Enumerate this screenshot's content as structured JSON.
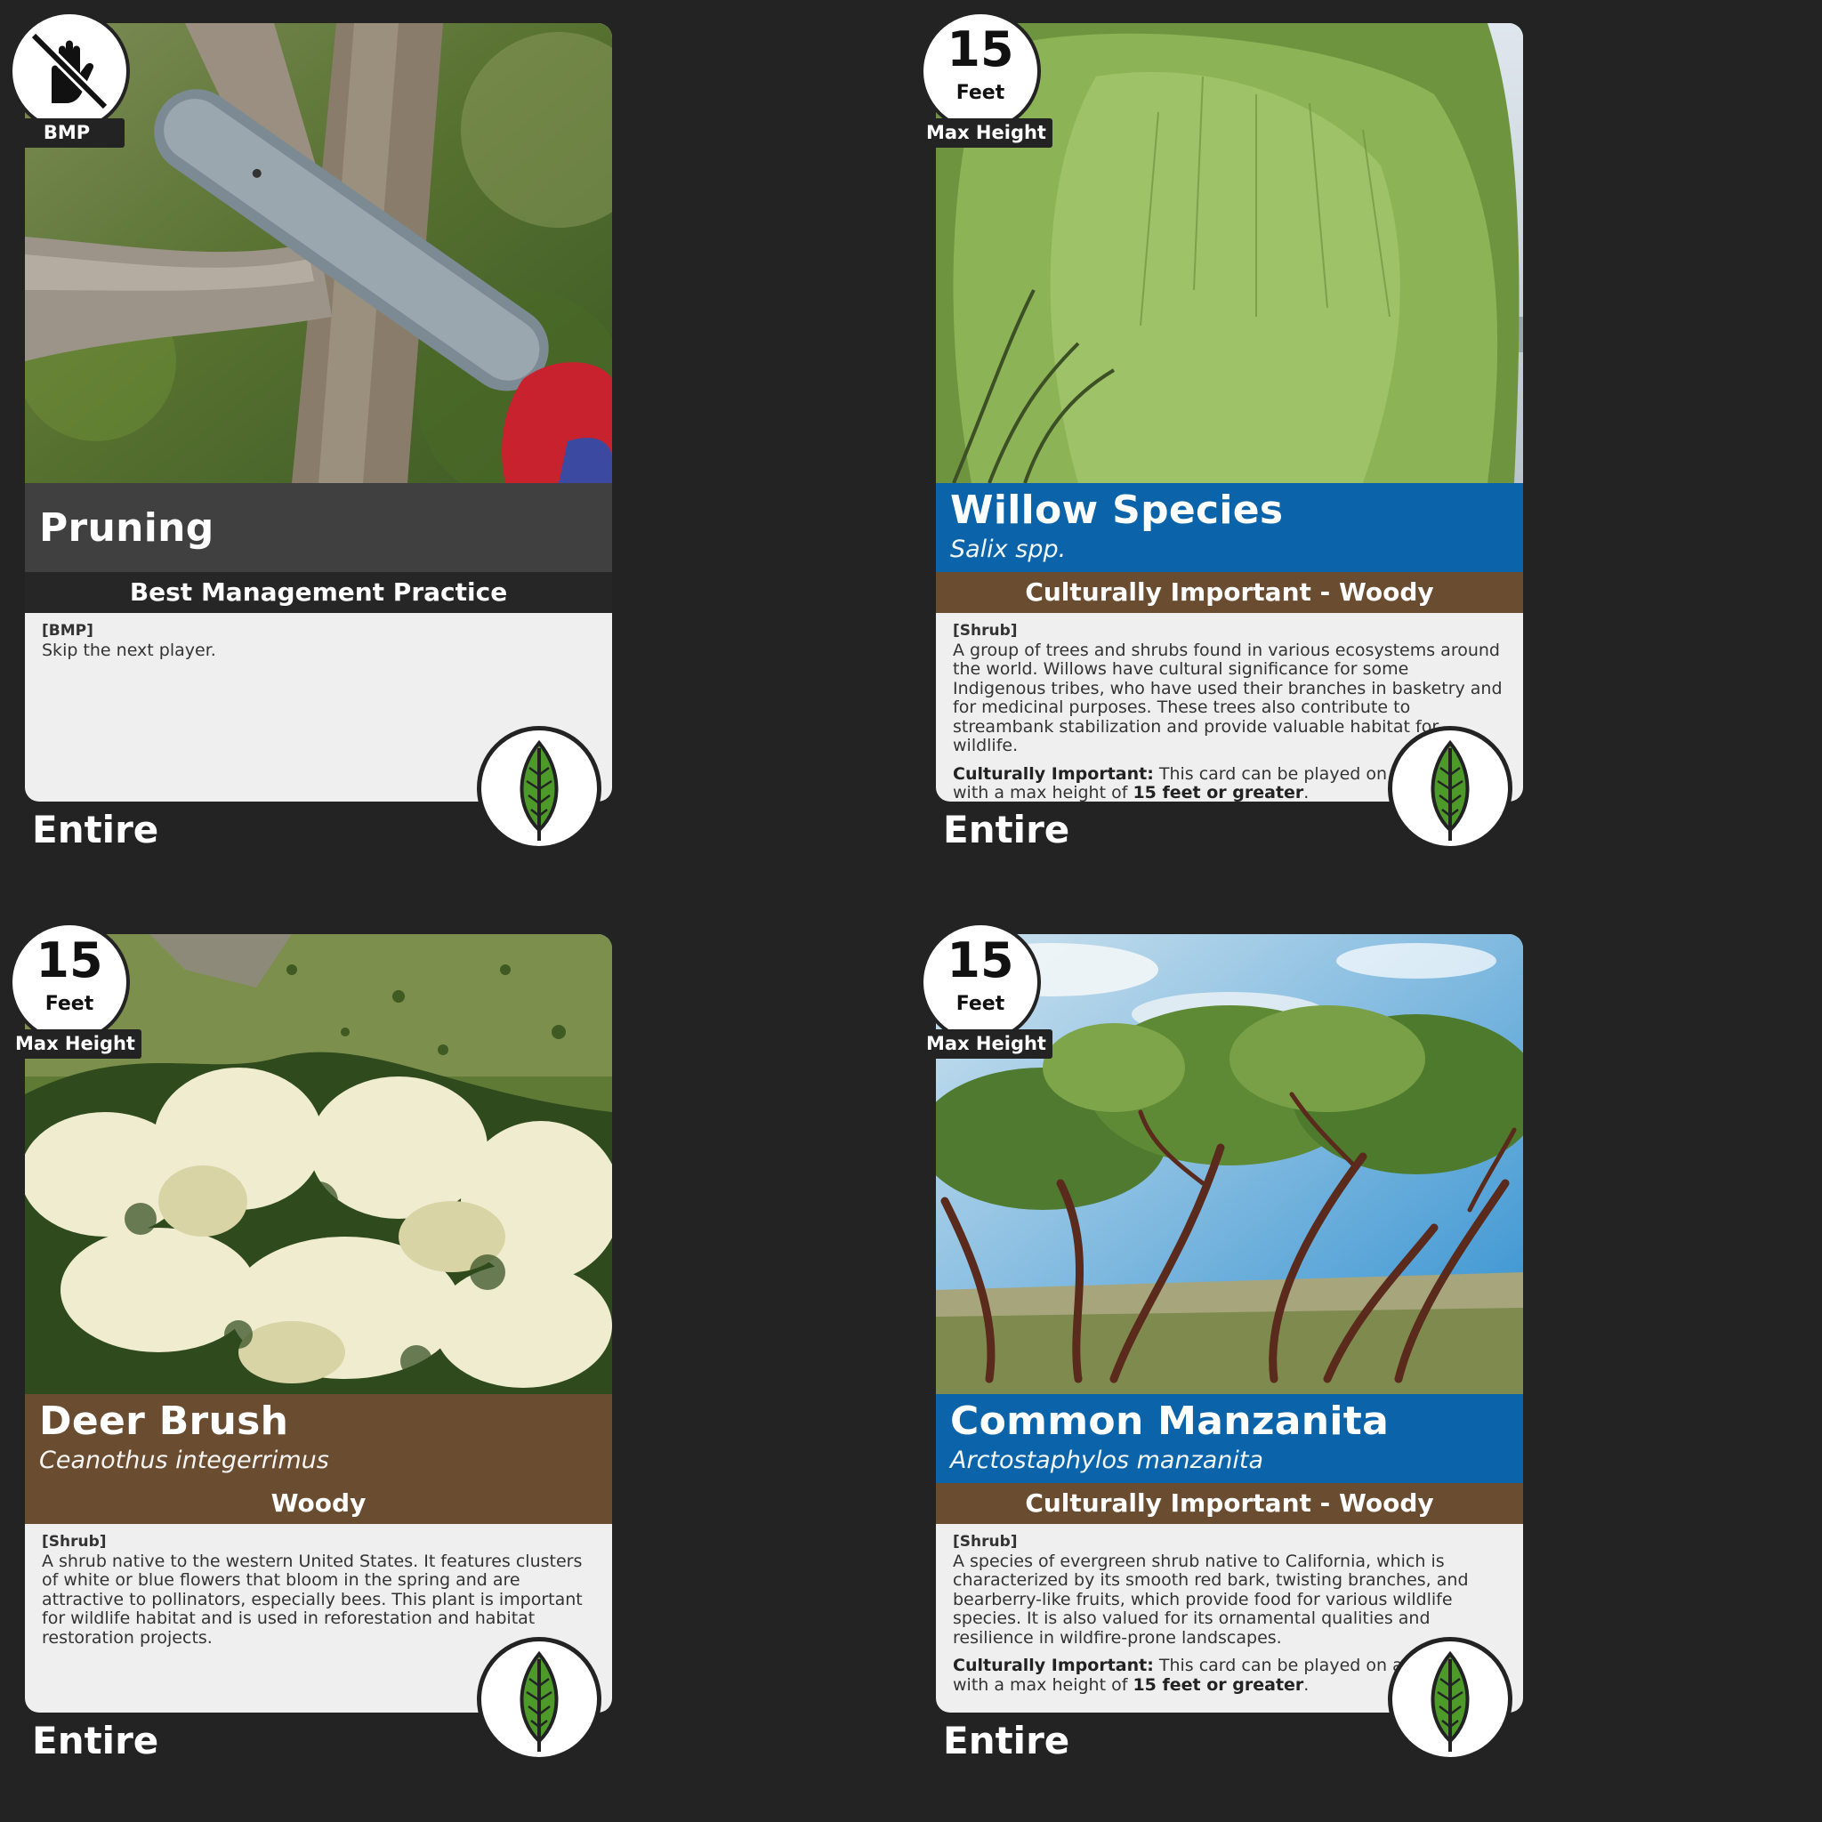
{
  "cards": [
    {
      "title": "Pruning",
      "scientific": "",
      "category": "Best Management Practice",
      "type_tag": "[BMP]",
      "description": "Skip the next player.",
      "note_bold": "",
      "note_text": "",
      "note_text_bold": "",
      "note_end": "",
      "margin": "Entire",
      "badge": {
        "icon": "no-hand-icon",
        "label": "BMP"
      },
      "colors": {
        "title_band": "#282828",
        "category_band": "#262626"
      }
    },
    {
      "title": "Willow Species",
      "scientific": "Salix spp.",
      "category": "Culturally Important - Woody",
      "type_tag": "[Shrub]",
      "description": "A group of trees and shrubs found in various ecosystems around the world. Willows have cultural significance for some Indigenous tribes, who have used their branches in basketry and for medicinal purposes. These trees also contribute to streambank stabilization and provide valuable habitat for wildlife.",
      "note_bold": "Culturally Important:",
      "note_text": " This card can be played on any species with a max height of ",
      "note_text_bold": "15 feet or greater",
      "note_end": ".",
      "margin": "Entire",
      "badge": {
        "number": "15",
        "unit": "Feet",
        "label": "Max Height"
      },
      "colors": {
        "title_band": "#0b64aa",
        "category_band": "#6a4c31"
      }
    },
    {
      "title": "Deer Brush",
      "scientific": "Ceanothus integerrimus",
      "category": "Woody",
      "type_tag": "[Shrub]",
      "description": "A shrub native to the western United States. It features clusters of white or blue flowers that bloom in the spring and are attractive to pollinators, especially bees. This plant is important for wildlife habitat and is used in reforestation and habitat restoration projects.",
      "note_bold": "",
      "note_text": "",
      "note_text_bold": "",
      "note_end": "",
      "margin": "Entire",
      "badge": {
        "number": "15",
        "unit": "Feet",
        "label": "Max Height"
      },
      "colors": {
        "title_band": "#6a4c31",
        "category_band": "#6a4c31"
      }
    },
    {
      "title": "Common Manzanita",
      "scientific": "Arctostaphylos manzanita",
      "category": "Culturally Important - Woody",
      "type_tag": "[Shrub]",
      "description": "A species of evergreen shrub native to California, which is characterized by its smooth red bark, twisting branches, and bearberry-like fruits, which provide food for various wildlife species. It is also valued for its ornamental qualities and resilience in wildfire-prone landscapes.",
      "note_bold": "Culturally Important:",
      "note_text": " This card can be played on any species with a max height of ",
      "note_text_bold": "15 feet or greater",
      "note_end": ".",
      "margin": "Entire",
      "badge": {
        "number": "15",
        "unit": "Feet",
        "label": "Max Height"
      },
      "colors": {
        "title_band": "#0b64aa",
        "category_band": "#6a4c31"
      }
    }
  ],
  "leaf_icon": "leaf-icon",
  "colors": {
    "background": "#232323",
    "leaf_green": "#4d9a2a"
  }
}
